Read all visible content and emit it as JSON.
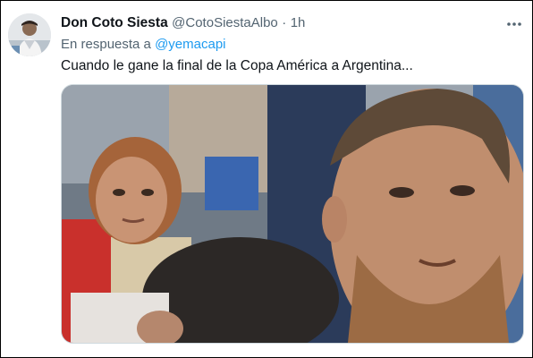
{
  "tweet": {
    "author_name": "Don Coto Siesta",
    "handle": "@CotoSiestaAlbo",
    "separator": "·",
    "time": "1h",
    "reply_prefix": "En respuesta a",
    "reply_to": "@yemacapi",
    "text": "Cuando le gane la final de la Copa América a Argentina...",
    "more_icon": "more-horizontal-icon"
  },
  "colors": {
    "accent": "#1d9bf0",
    "text_primary": "#0f1419",
    "text_secondary": "#536471"
  }
}
